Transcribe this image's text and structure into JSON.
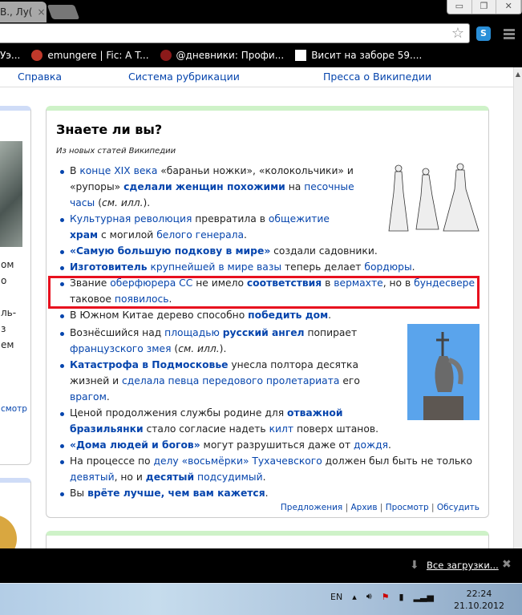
{
  "browser": {
    "tab_title": "В., Лу(",
    "tab_close": "×",
    "star": "☆",
    "skype": "S",
    "window_controls": [
      "▭",
      "❐",
      "✕"
    ]
  },
  "bookmarks": [
    {
      "label": "Уэ...",
      "color": "#000"
    },
    {
      "label": "emungere | Fic: A T...",
      "color": "#c0392b"
    },
    {
      "label": "@дневники: Профи...",
      "color": "#8b1a1a"
    },
    {
      "label": "Висит на заборе 59....",
      "color": "#fff"
    }
  ],
  "topnav": [
    "Справка",
    "Система рубрикации",
    "Пресса о Википедии"
  ],
  "left_fragments": [
    "ом",
    "о",
    "",
    "ль-",
    "з",
    "ем",
    "",
    "",
    "",
    "смотр"
  ],
  "dyk": {
    "title": "Знаете ли вы?",
    "subtitle": "Из новых статей Википедии",
    "items": [
      [
        [
          "n",
          "В "
        ],
        [
          "l",
          "конце XIX века"
        ],
        [
          "n",
          " «бараньи ножки», «колокольчики» и «рупоры» "
        ],
        [
          "b",
          "сделали женщин похожими"
        ],
        [
          "n",
          " на "
        ],
        [
          "l",
          "песочные часы"
        ],
        [
          "n",
          " ("
        ],
        [
          "i",
          "см. илл."
        ],
        [
          "n",
          ")."
        ]
      ],
      [
        [
          "l",
          "Культурная революция"
        ],
        [
          "n",
          " превратила в "
        ],
        [
          "l",
          "общежитие"
        ],
        [
          "n",
          " "
        ],
        [
          "b",
          "храм"
        ],
        [
          "n",
          " с могилой "
        ],
        [
          "l",
          "белого генерала"
        ],
        [
          "n",
          "."
        ]
      ],
      [
        [
          "b",
          "«Самую большую подкову в мире»"
        ],
        [
          "n",
          " создали садовники."
        ]
      ],
      [
        [
          "b",
          "Изготовитель"
        ],
        [
          "n",
          " "
        ],
        [
          "l",
          "крупнейшей в мире вазы"
        ],
        [
          "n",
          " теперь делает "
        ],
        [
          "l",
          "бордюры"
        ],
        [
          "n",
          "."
        ]
      ],
      [
        [
          "n",
          "Звание "
        ],
        [
          "l",
          "оберфюрера СС"
        ],
        [
          "n",
          " не имело "
        ],
        [
          "b",
          "соответствия"
        ],
        [
          "n",
          " в "
        ],
        [
          "l",
          "вермахте"
        ],
        [
          "n",
          ", но в "
        ],
        [
          "l",
          "бундесвере"
        ],
        [
          "n",
          " таковое "
        ],
        [
          "l",
          "появилось"
        ],
        [
          "n",
          "."
        ]
      ],
      [
        [
          "n",
          "В Южном Китае дерево способно "
        ],
        [
          "b",
          "победить дом"
        ],
        [
          "n",
          "."
        ]
      ],
      [
        [
          "n",
          "Вознёсшийся над "
        ],
        [
          "l",
          "площадью"
        ],
        [
          "n",
          " "
        ],
        [
          "b",
          "русский ангел"
        ],
        [
          "n",
          " попирает "
        ],
        [
          "l",
          "французского змея"
        ],
        [
          "n",
          " ("
        ],
        [
          "i",
          "см. илл."
        ],
        [
          "n",
          ")."
        ]
      ],
      [
        [
          "b",
          "Катастрофа в Подмосковье"
        ],
        [
          "n",
          " унесла полтора десятка жизней и "
        ],
        [
          "l",
          "сделала певца передового пролетариата"
        ],
        [
          "n",
          " его "
        ],
        [
          "l",
          "врагом"
        ],
        [
          "n",
          "."
        ]
      ],
      [
        [
          "n",
          "Ценой продолжения службы родине для "
        ],
        [
          "b",
          "отважной бразильянки"
        ],
        [
          "n",
          " стало согласие надеть "
        ],
        [
          "l",
          "килт"
        ],
        [
          "n",
          " поверх штанов."
        ]
      ],
      [
        [
          "b",
          "«Дома людей и богов»"
        ],
        [
          "n",
          " могут разрушиться даже от "
        ],
        [
          "l",
          "дождя"
        ],
        [
          "n",
          "."
        ]
      ],
      [
        [
          "n",
          "На процессе по "
        ],
        [
          "l",
          "делу «восьмёрки» Тухачевского"
        ],
        [
          "n",
          " должен был быть не только "
        ],
        [
          "l",
          "девятый"
        ],
        [
          "n",
          ", но и "
        ],
        [
          "b",
          "десятый"
        ],
        [
          "n",
          " "
        ],
        [
          "l",
          "подсудимый"
        ],
        [
          "n",
          "."
        ]
      ],
      [
        [
          "n",
          "Вы "
        ],
        [
          "b",
          "врёте лучше, чем вам кажется"
        ],
        [
          "n",
          "."
        ]
      ]
    ],
    "footer_links": [
      "Предложения",
      "Архив",
      "Просмотр",
      "Обсудить"
    ]
  },
  "downloads": {
    "label": "Все загрузки...",
    "close": "✖",
    "icon": "⬇"
  },
  "taskbar": {
    "lang": "EN",
    "time": "22:24",
    "date": "21.10.2012"
  },
  "colors": {
    "link": "#0645ad",
    "highlight": "#e8101e"
  }
}
